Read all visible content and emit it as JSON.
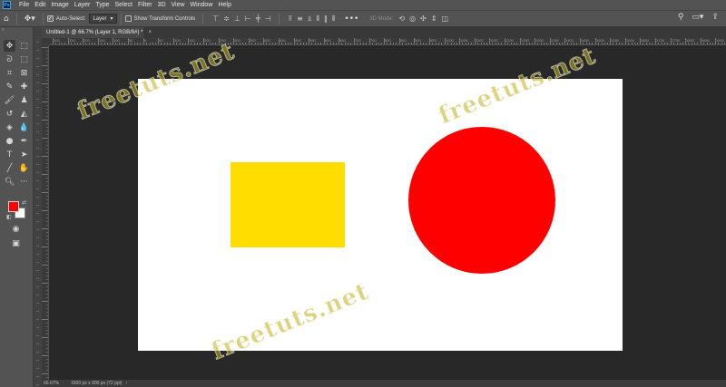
{
  "menubar": {
    "logo": "Ps",
    "items": [
      "File",
      "Edit",
      "Image",
      "Layer",
      "Type",
      "Select",
      "Filter",
      "3D",
      "View",
      "Window",
      "Help"
    ]
  },
  "options": {
    "auto_select_label": "Auto-Select:",
    "auto_select_checked": true,
    "target_select": "Layer",
    "transform_label": "Show Transform Controls",
    "transform_checked": false,
    "mode_3d_label": "3D Mode:"
  },
  "document_tab": {
    "title": "Untitled-1 @ 66.7% (Layer 1, RGB/8#) *",
    "close_glyph": "×"
  },
  "ruler": {
    "top_labels": [
      "300",
      "250",
      "200",
      "150",
      "100",
      "50",
      "0",
      "50",
      "100",
      "150",
      "200",
      "250",
      "300",
      "350",
      "400",
      "450",
      "500",
      "550",
      "600",
      "650",
      "700",
      "750",
      "800",
      "850",
      "900",
      "950",
      "1000",
      "1050",
      "1100",
      "1150",
      "1200",
      "1250",
      "1300",
      "1350",
      "1400",
      "1450",
      "1500",
      "1550",
      "1600",
      "1650",
      "1700",
      "1750",
      "1800",
      "1850",
      "1900"
    ]
  },
  "watermark": {
    "text": "freetuts.net"
  },
  "colors": {
    "foreground": "#ff0000",
    "background": "#ffffff",
    "rect_fill": "#ffdd00",
    "circle_fill": "#ff0000",
    "canvas": "#ffffff"
  },
  "status": {
    "zoom": "66.67%",
    "doc_info": "1600 px x 900 px (72 ppi)",
    "arrow": "›"
  }
}
